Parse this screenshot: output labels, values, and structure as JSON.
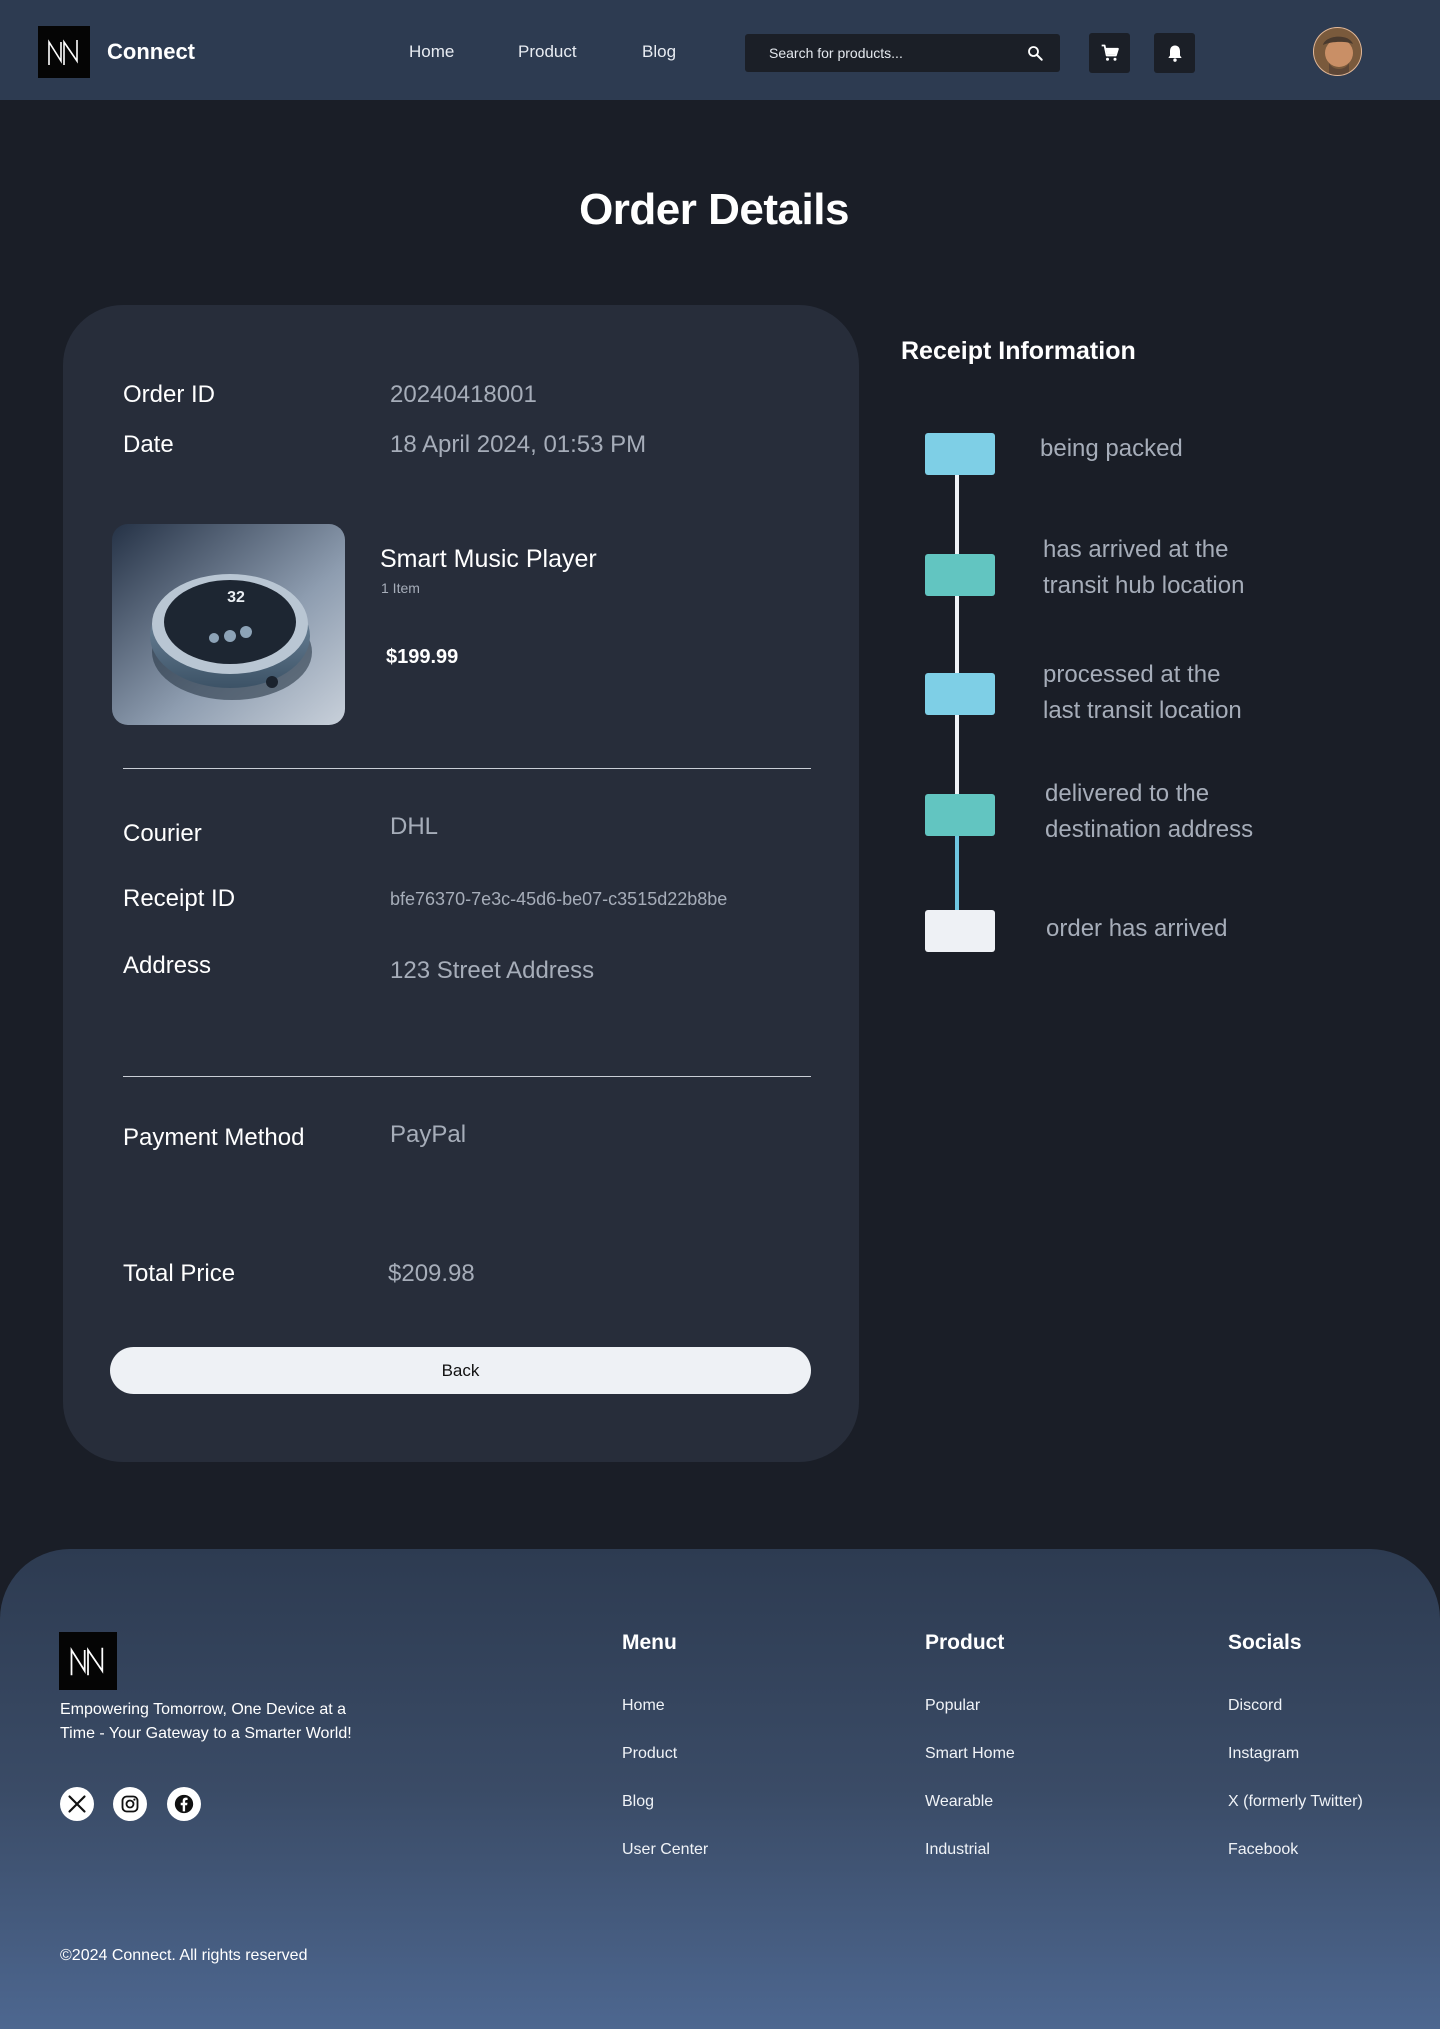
{
  "header": {
    "brand": "Connect",
    "nav": [
      "Home",
      "Product",
      "Blog"
    ],
    "search_placeholder": "Search for products..."
  },
  "page_title": "Order Details",
  "order": {
    "order_id_label": "Order ID",
    "order_id": "20240418001",
    "date_label": "Date",
    "date": "18 April 2024, 01:53 PM",
    "product": {
      "name": "Smart Music Player",
      "quantity": "1 Item",
      "price": "$199.99",
      "image_display": "32"
    },
    "courier_label": "Courier",
    "courier": "DHL",
    "receipt_id_label": "Receipt ID",
    "receipt_id": "bfe76370-7e3c-45d6-be07-c3515d22b8be",
    "address_label": "Address",
    "address": "123 Street Address",
    "payment_label": "Payment Method",
    "payment": "PayPal",
    "total_label": "Total Price",
    "total": "$209.98",
    "back_label": "Back"
  },
  "receipt": {
    "title": "Receipt Information",
    "steps": [
      {
        "line1": "being packed",
        "line2": "",
        "color": "#7ecfe6"
      },
      {
        "line1": "has arrived at the",
        "line2": "transit hub location",
        "color": "#62c5c1"
      },
      {
        "line1": "processed at the",
        "line2": "last transit location",
        "color": "#7ecfe6"
      },
      {
        "line1": "delivered to the",
        "line2": "destination address",
        "color": "#62c5c1"
      },
      {
        "line1": "order has arrived",
        "line2": "",
        "color": "#eef1f5"
      }
    ]
  },
  "footer": {
    "tagline": "Empowering Tomorrow, One Device at a Time - Your Gateway to a Smarter World!",
    "socials_icons": [
      "x-icon",
      "instagram-icon",
      "facebook-icon"
    ],
    "menu": {
      "title": "Menu",
      "items": [
        "Home",
        "Product",
        "Blog",
        "User Center"
      ]
    },
    "product": {
      "title": "Product",
      "items": [
        "Popular",
        "Smart Home",
        "Wearable",
        "Industrial"
      ]
    },
    "socials": {
      "title": "Socials",
      "items": [
        "Discord",
        "Instagram",
        "X (formerly Twitter)",
        "Facebook"
      ]
    },
    "copyright": "©2024 Connect. All rights reserved"
  },
  "colors": {
    "nav_bg": "#2d3b51",
    "page_bg": "#1a1e27",
    "card_bg": "#272d3a",
    "accent_blue": "#7ecfe6",
    "accent_teal": "#62c5c1"
  }
}
